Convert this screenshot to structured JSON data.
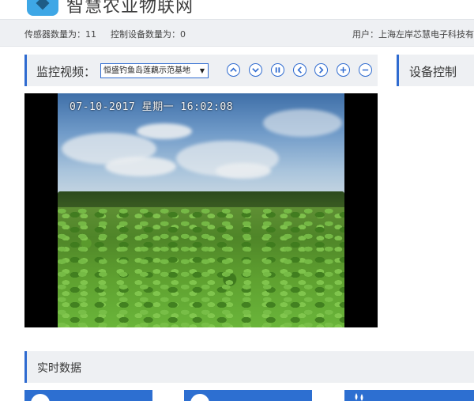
{
  "header": {
    "title": "智慧农业物联网"
  },
  "info": {
    "sensor_count": "传感器数量为：11",
    "device_count": "控制设备数量为：0",
    "user": "用户：上海左岸芯慧电子科技有"
  },
  "monitor": {
    "title": "监控视频：",
    "selected_camera": "恒盛钓鱼岛莲藕示范基地",
    "select_arrow": "▼",
    "controls": [
      "up",
      "down",
      "pause",
      "left",
      "right",
      "zoom-in",
      "zoom-out"
    ],
    "timestamp": "07-10-2017 星期一 16:02:08"
  },
  "device": {
    "title": "设备控制"
  },
  "realtime": {
    "title": "实时数据"
  },
  "colors": {
    "accent": "#2f6bd0",
    "card": "#2d6fd1",
    "bar_bg": "#eef0f3"
  }
}
